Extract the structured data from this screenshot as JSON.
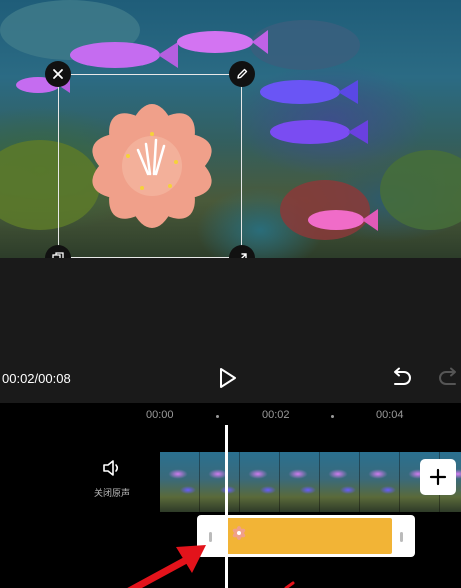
{
  "player": {
    "time_display": "00:02/00:08"
  },
  "timeline": {
    "ticks": [
      "00:00",
      "00:02",
      "00:04"
    ],
    "mute_label": "关闭原声"
  },
  "icons": {
    "close": "close-icon",
    "edit": "pencil-icon",
    "copy": "copy-icon",
    "scale": "scale-icon",
    "play": "play-icon",
    "undo": "undo-icon",
    "redo": "redo-icon",
    "speaker": "speaker-icon",
    "add": "plus-icon",
    "sticker": "flower-sticker",
    "annotation": "red-arrow"
  },
  "colors": {
    "sticker_clip": "#f2b436",
    "flower": "#f0a08a",
    "annotation_arrow": "#e3131b"
  }
}
